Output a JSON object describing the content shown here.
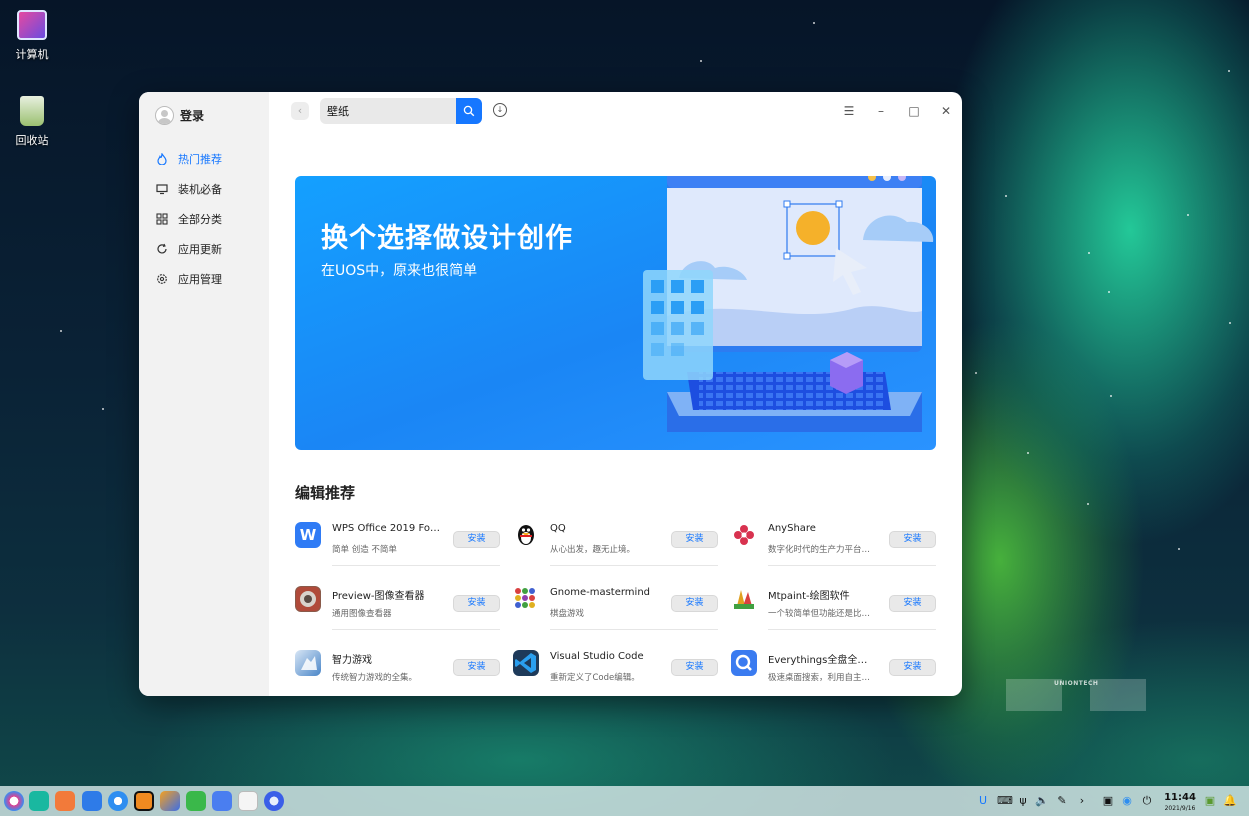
{
  "desktop": {
    "icons": [
      {
        "label": "计算机"
      },
      {
        "label": "回收站"
      }
    ],
    "watermark": "UNIONTECH"
  },
  "window": {
    "sidebar": {
      "login_label": "登录",
      "nav": [
        {
          "label": "热门推荐",
          "icon": "flame-icon",
          "active": true
        },
        {
          "label": "装机必备",
          "icon": "monitor-icon"
        },
        {
          "label": "全部分类",
          "icon": "grid-icon"
        },
        {
          "label": "应用更新",
          "icon": "refresh-icon"
        },
        {
          "label": "应用管理",
          "icon": "gear-icon"
        }
      ]
    },
    "topbar": {
      "search_value": "壁纸",
      "search_icon": "search-icon",
      "download_icon": "download-icon"
    },
    "banner": {
      "title": "换个选择做设计创作",
      "subtitle": "在UOS中，原来也很简单"
    },
    "section_title": "编辑推荐",
    "install_label": "安装",
    "apps": [
      {
        "name": "WPS Office 2019 For Li…",
        "desc": "简单 创造 不简单",
        "color": "#2f7bf5"
      },
      {
        "name": "QQ",
        "desc": "从心出发，趣无止境。",
        "color": "#111111"
      },
      {
        "name": "AnyShare",
        "desc": "数字化时代的生产力平台，…",
        "color": "#d8324f"
      },
      {
        "name": "Preview-图像查看器",
        "desc": "通用图像查看器",
        "color": "#8a5a4a"
      },
      {
        "name": "Gnome-mastermind",
        "desc": "棋盘游戏",
        "color": "#7a7a7a"
      },
      {
        "name": "Mtpaint-绘图软件",
        "desc": "一个较简单但功能还是比较…",
        "color": "#e0a020"
      },
      {
        "name": "智力游戏",
        "desc": "传统智力游戏的全集。",
        "color": "#4a86c8"
      },
      {
        "name": "Visual Studio Code",
        "desc": "重新定义了Code编辑。",
        "color": "#1e4f8a"
      },
      {
        "name": "Everythings全盘全文…",
        "desc": "极速桌面搜索，利用自主研…",
        "color": "#3a7bf0"
      }
    ]
  },
  "taskbar": {
    "time": "11:44",
    "date": "2021/9/16"
  }
}
